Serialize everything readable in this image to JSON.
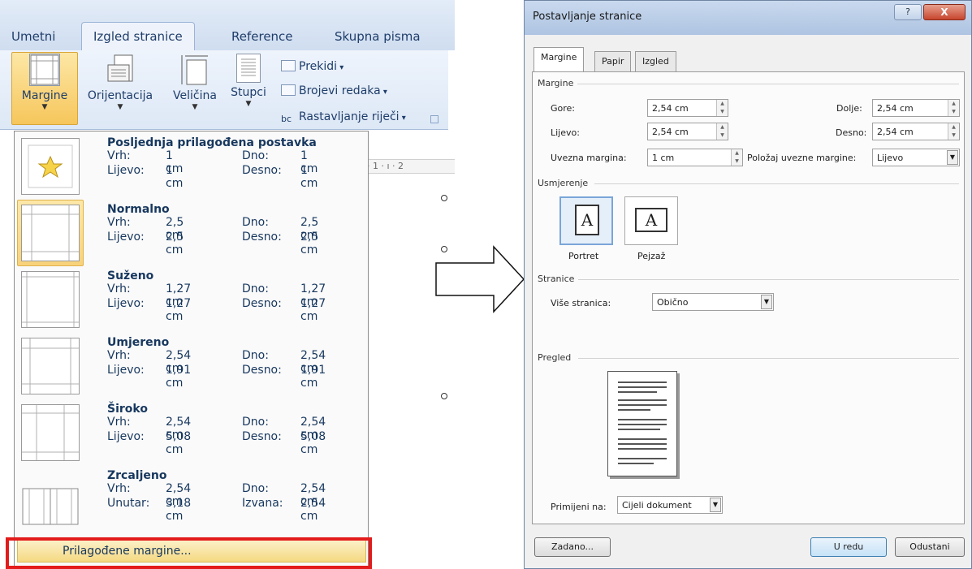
{
  "ribbon": {
    "tabs": [
      "Umetni",
      "Izgled stranice",
      "Reference",
      "Skupna pisma"
    ],
    "active_tab": "Izgled stranice",
    "buttons": [
      "Margine",
      "Orijentacija",
      "Veličina",
      "Stupci"
    ],
    "small_commands": [
      "Prekidi",
      "Brojevi redaka",
      "Rastavljanje riječi"
    ],
    "ruler_text": "· 1 · ı · 2"
  },
  "margins_menu": {
    "items": [
      {
        "title": "Posljednja prilagođena postavka",
        "l1": "Vrh:",
        "v1": "1 cm",
        "l2": "Dno:",
        "v2": "1 cm",
        "l3": "Lijevo:",
        "v3": "1 cm",
        "l4": "Desno:",
        "v4": "1 cm"
      },
      {
        "title": "Normalno",
        "l1": "Vrh:",
        "v1": "2,5 cm",
        "l2": "Dno:",
        "v2": "2,5 cm",
        "l3": "Lijevo:",
        "v3": "2,5 cm",
        "l4": "Desno:",
        "v4": "2,5 cm"
      },
      {
        "title": "Suženo",
        "l1": "Vrh:",
        "v1": "1,27 cm",
        "l2": "Dno:",
        "v2": "1,27 cm",
        "l3": "Lijevo:",
        "v3": "1,27 cm",
        "l4": "Desno:",
        "v4": "1,27 cm"
      },
      {
        "title": "Umjereno",
        "l1": "Vrh:",
        "v1": "2,54 cm",
        "l2": "Dno:",
        "v2": "2,54 cm",
        "l3": "Lijevo:",
        "v3": "1,91 cm",
        "l4": "Desno:",
        "v4": "1,91 cm"
      },
      {
        "title": "Široko",
        "l1": "Vrh:",
        "v1": "2,54 cm",
        "l2": "Dno:",
        "v2": "2,54 cm",
        "l3": "Lijevo:",
        "v3": "5,08 cm",
        "l4": "Desno:",
        "v4": "5,08 cm"
      },
      {
        "title": "Zrcaljeno",
        "l1": "Vrh:",
        "v1": "2,54 cm",
        "l2": "Dno:",
        "v2": "2,54 cm",
        "l3": "Unutar:",
        "v3": "3,18 cm",
        "l4": "Izvana:",
        "v4": "2,54 cm"
      }
    ],
    "custom_margins": "Prilagođene margine..."
  },
  "dialog": {
    "title": "Postavljanje stranice",
    "help_btn": "?",
    "close_btn": "X",
    "tabs": [
      "Margine",
      "Papir",
      "Izgled"
    ],
    "margins_section": "Margine",
    "top_label": "Gore:",
    "top_value": "2,54 cm",
    "bottom_label": "Dolje:",
    "bottom_value": "2,54 cm",
    "left_label": "Lijevo:",
    "left_value": "2,54 cm",
    "right_label": "Desno:",
    "right_value": "2,54 cm",
    "gutter_label": "Uvezna margina:",
    "gutter_value": "1 cm",
    "gutter_pos_label": "Položaj uvezne margine:",
    "gutter_pos_value": "Lijevo",
    "orientation_section": "Usmjerenje",
    "portrait": "Portret",
    "landscape": "Pejzaž",
    "orient_glyph": "A",
    "pages_section": "Stranice",
    "multiple_pages_label": "Više stranica:",
    "multiple_pages_value": "Obično",
    "preview_section": "Pregled",
    "apply_to_label": "Primijeni na:",
    "apply_to_value": "Cijeli dokument",
    "default_btn": "Zadano...",
    "ok_btn": "U redu",
    "cancel_btn": "Odustani"
  }
}
